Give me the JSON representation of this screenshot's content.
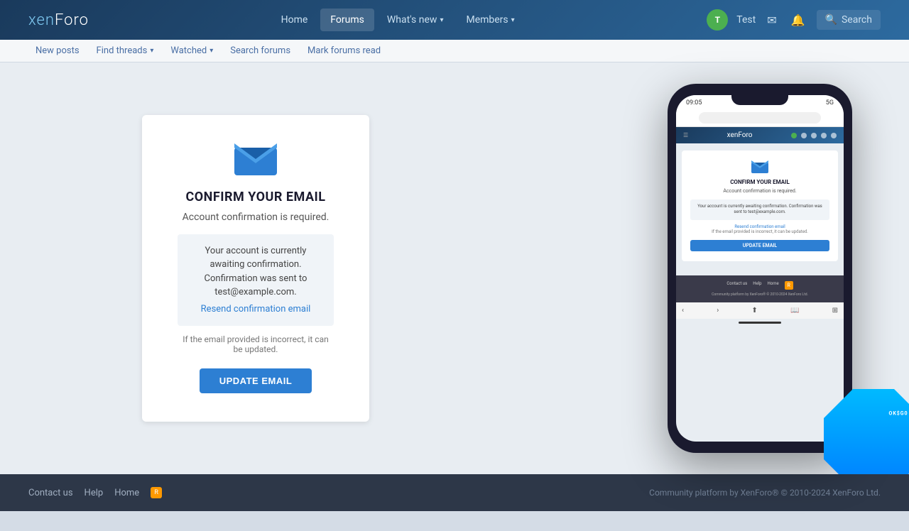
{
  "header": {
    "logo_xen": "xen",
    "logo_foro": "Foro",
    "nav": {
      "home": "Home",
      "forums": "Forums",
      "whats_new": "What's new",
      "members": "Members"
    },
    "user": {
      "initial": "T",
      "name": "Test"
    },
    "search_label": "Search"
  },
  "subnav": {
    "new_posts": "New posts",
    "find_threads": "Find threads",
    "watched": "Watched",
    "search_forums": "Search forums",
    "mark_forums_read": "Mark forums read"
  },
  "confirm_card": {
    "title": "CONFIRM YOUR EMAIL",
    "subtitle": "Account confirmation is required.",
    "box_text": "Your account is currently awaiting confirmation. Confirmation was sent to test@example.com.",
    "resend_link": "Resend confirmation email",
    "note": "If the email provided is incorrect, it can be updated.",
    "button": "UPDATE EMAIL"
  },
  "phone": {
    "time": "09:05",
    "signal": "5G",
    "title": "CONFIRM YOUR EMAIL",
    "subtitle": "Account confirmation is required.",
    "box_text": "Your account is currently awaiting confirmation. Confirmation was sent to test@example.com.",
    "resend_link": "Resend confirmation email",
    "note": "If the email provided is incorrect, it can be updated.",
    "button": "UPDATE EMAIL",
    "footer_links": [
      "Contact us",
      "Help",
      "Home"
    ],
    "footer_copy": "Community platform by XenForo® © 2010-2024 XenForo Ltd."
  },
  "footer": {
    "links": [
      "Contact us",
      "Help",
      "Home"
    ],
    "copy": "Community platform by XenForo® © 2010-2024 XenForo Ltd."
  }
}
